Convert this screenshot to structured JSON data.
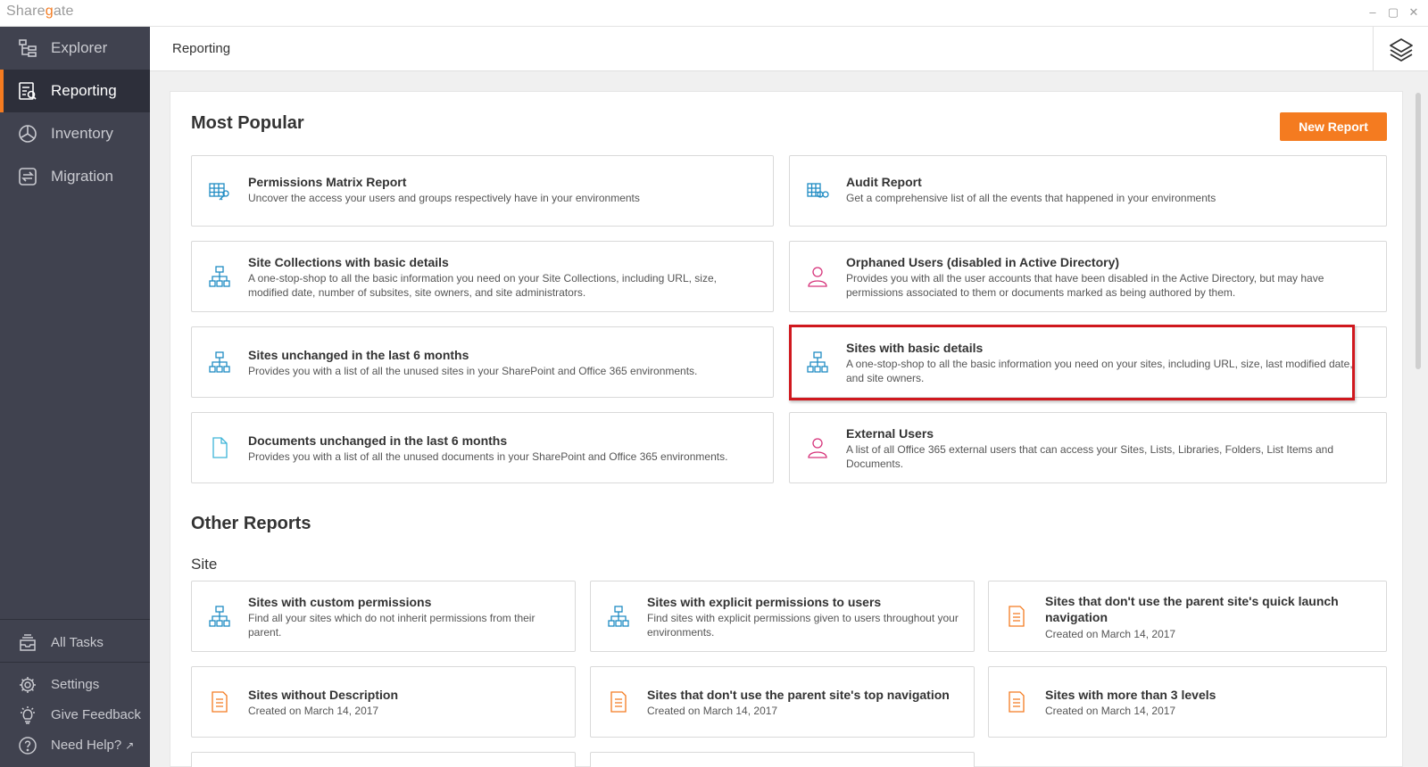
{
  "app": {
    "logo": "Sharegate",
    "logo_prefix": "Share",
    "logo_g": "g",
    "logo_suffix": "ate"
  },
  "window_controls": [
    "–",
    "▢",
    "✕"
  ],
  "sidebar": {
    "items": [
      {
        "label": "Explorer",
        "icon": "explorer-tree-icon"
      },
      {
        "label": "Reporting",
        "icon": "report-icon",
        "active": true
      },
      {
        "label": "Inventory",
        "icon": "inventory-chart-icon"
      },
      {
        "label": "Migration",
        "icon": "migration-arrows-icon"
      }
    ],
    "bottom": [
      {
        "label": "All Tasks",
        "icon": "tray-icon"
      },
      {
        "label": "Settings",
        "icon": "gear-icon"
      },
      {
        "label": "Give Feedback",
        "icon": "lightbulb-icon"
      },
      {
        "label": "Need Help?",
        "icon": "help-icon",
        "ext": "↗"
      }
    ]
  },
  "header": {
    "title": "Reporting",
    "layers_icon": "layers-icon"
  },
  "main": {
    "most_popular_title": "Most Popular",
    "new_report_label": "New Report",
    "popular": [
      {
        "title": "Permissions Matrix Report",
        "desc": "Uncover the access your users and groups respectively have in your environments",
        "icon": "permissions-matrix-icon"
      },
      {
        "title": "Audit Report",
        "desc": "Get a comprehensive list of all the events that happened in your environments",
        "icon": "audit-icon"
      },
      {
        "title": "Site Collections with basic details",
        "desc": "A one-stop-shop to all the basic information you need on your Site Collections, including URL, size, modified date, number of subsites, site owners, and site administrators.",
        "icon": "site-hierarchy-icon"
      },
      {
        "title": "Orphaned Users (disabled in Active Directory)",
        "desc": "Provides you with all the user accounts that have been disabled in the Active Directory, but may have permissions associated to them or documents marked as being authored by them.",
        "icon": "user-icon"
      },
      {
        "title": "Sites unchanged in the last 6 months",
        "desc": "Provides you with a list of all the unused sites in your SharePoint and Office 365 environments.",
        "icon": "site-hierarchy-icon"
      },
      {
        "title": "Sites with basic details",
        "desc": "A one-stop-shop to all the basic information you need on your sites, including URL, size, last modified date, and site owners.",
        "icon": "site-hierarchy-icon"
      },
      {
        "title": "Documents unchanged in the last 6 months",
        "desc": "Provides you with a list of all the unused documents in your SharePoint and Office 365 environments.",
        "icon": "document-icon"
      },
      {
        "title": "External Users",
        "desc": "A list of all Office 365 external users that can access your Sites, Lists, Libraries, Folders, List Items and Documents.",
        "icon": "user-icon"
      }
    ],
    "other_reports_title": "Other Reports",
    "site_section_title": "Site",
    "other": [
      {
        "title": "Sites with custom permissions",
        "desc": "Find all your sites which do not inherit permissions from their parent.",
        "icon": "site-hierarchy-icon"
      },
      {
        "title": "Sites with explicit permissions to users",
        "desc": "Find sites with explicit permissions given to users throughout your environments.",
        "icon": "site-hierarchy-icon"
      },
      {
        "title": "Sites that don't use the parent site's quick launch navigation",
        "desc": "Created on March 14, 2017",
        "icon": "custom-report-icon"
      },
      {
        "title": "Sites without Description",
        "desc": "Created on March 14, 2017",
        "icon": "custom-report-icon"
      },
      {
        "title": "Sites that don't use the parent site's top navigation",
        "desc": "Created on March 14, 2017",
        "icon": "custom-report-icon"
      },
      {
        "title": "Sites with more than 3 levels",
        "desc": "Created on March 14, 2017",
        "icon": "custom-report-icon"
      }
    ]
  },
  "colors": {
    "accent": "#f47b20",
    "sidebar_bg": "#40424f",
    "sidebar_active": "#2d2f3a",
    "icon_blue": "#1e8bc3",
    "icon_pink": "#d6337a",
    "highlight": "#d0181e"
  }
}
